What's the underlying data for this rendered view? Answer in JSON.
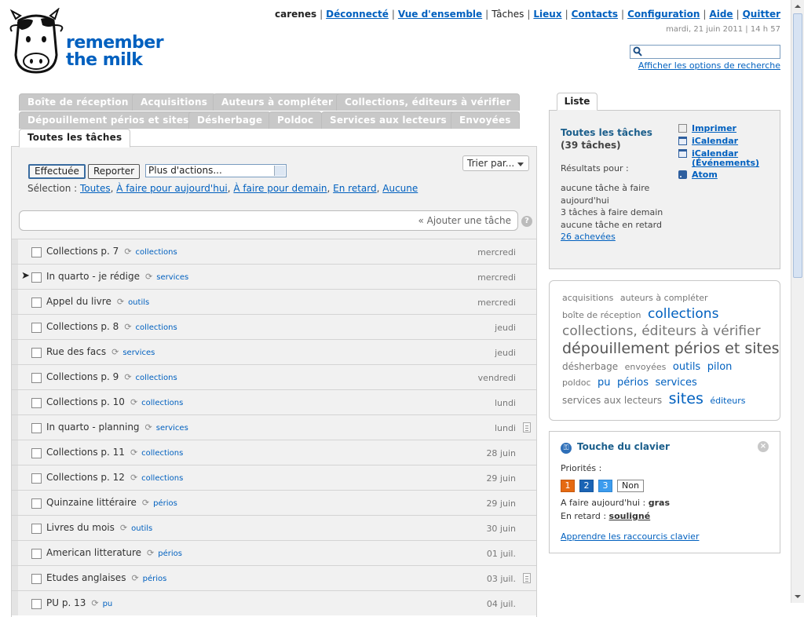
{
  "logo": {
    "line1": "remember",
    "line2": "the milk"
  },
  "topnav": {
    "user": "carenes",
    "logout": "Déconnecté",
    "overview": "Vue d'ensemble",
    "tasks": "Tâches",
    "places": "Lieux",
    "contacts": "Contacts",
    "settings": "Configuration",
    "help": "Aide",
    "quit": "Quitter"
  },
  "datetime": "mardi, 21 juin 2011 | 14 h 57",
  "search": {
    "value": "",
    "options_link": "Afficher les options de recherche"
  },
  "tabs": {
    "inbox": "Boîte de réception",
    "acquisitions": "Acquisitions",
    "authors": "Auteurs à compléter",
    "collections": "Collections, éditeurs à vérifier",
    "depouillement": "Dépouillement périos et sites",
    "desherbage": "Désherbage",
    "poldoc": "Poldoc",
    "services": "Services aux lecteurs",
    "sent": "Envoyées",
    "all": "Toutes les tâches"
  },
  "toolbar": {
    "done": "Effectuée",
    "postpone": "Reporter",
    "more_actions": "Plus d'actions...",
    "sort": "Trier par..."
  },
  "selection": {
    "label": "Sélection :",
    "all": "Toutes",
    "today": "À faire pour aujourd'hui",
    "tomorrow": "À faire pour demain",
    "overdue": "En retard",
    "none": "Aucune"
  },
  "add_task": "« Ajouter une tâche",
  "help_glyph": "?",
  "tasks": [
    {
      "name": "Collections p. 7",
      "tag": "collections",
      "date": "mercredi"
    },
    {
      "name": "In quarto - je rédige",
      "tag": "services",
      "date": "mercredi"
    },
    {
      "name": "Appel du livre",
      "tag": "outils",
      "date": "mercredi"
    },
    {
      "name": "Collections p. 8",
      "tag": "collections",
      "date": "jeudi"
    },
    {
      "name": "Rue des facs",
      "tag": "services",
      "date": "jeudi"
    },
    {
      "name": "Collections p. 9",
      "tag": "collections",
      "date": "vendredi"
    },
    {
      "name": "Collections p. 10",
      "tag": "collections",
      "date": "lundi"
    },
    {
      "name": "In quarto - planning",
      "tag": "services",
      "date": "lundi"
    },
    {
      "name": "Collections p. 11",
      "tag": "collections",
      "date": "28 juin"
    },
    {
      "name": "Collections p. 12",
      "tag": "collections",
      "date": "29 juin"
    },
    {
      "name": "Quinzaine littéraire",
      "tag": "périos",
      "date": "29 juin"
    },
    {
      "name": "Livres du mois",
      "tag": "outils",
      "date": "30 juin"
    },
    {
      "name": "American litterature",
      "tag": "périos",
      "date": "01 juil."
    },
    {
      "name": "Etudes anglaises",
      "tag": "périos",
      "date": "03 juil."
    },
    {
      "name": "PU p. 13",
      "tag": "pu",
      "date": "04 juil."
    }
  ],
  "list_panel": {
    "tab": "Liste",
    "title": "Toutes les tâches",
    "count": "(39 tâches)",
    "results_label": "Résultats pour :",
    "today": "aucune tâche à faire aujourd'hui",
    "tomorrow": "3 tâches à faire demain",
    "overdue": "aucune tâche en retard",
    "completed": "26 achevées",
    "print": "Imprimer",
    "icalendar": "iCalendar",
    "icalendar_events": "iCalendar (Événements)",
    "atom": "Atom"
  },
  "tag_cloud": {
    "acquisitions": "acquisitions",
    "auteurs": "auteurs à compléter",
    "boite": "boîte de réception",
    "collections": "collections",
    "coll_editeurs": "collections, éditeurs à vérifier",
    "depouillement": "dépouillement périos et sites",
    "desherbage": "désherbage",
    "envoyees": "envoyées",
    "outils": "outils",
    "pilon": "pilon",
    "poldoc": "poldoc",
    "pu": "pu",
    "perios": "périos",
    "services": "services",
    "services_lecteurs": "services aux lecteurs",
    "sites": "sites",
    "editeurs": "éditeurs"
  },
  "keyboard": {
    "title": "Touche du clavier",
    "close_glyph": "×",
    "key_glyph": "⚿",
    "priorities_label": "Priorités :",
    "p1": "1",
    "p2": "2",
    "p3": "3",
    "pn": "Non",
    "today_label": "A faire aujourd'hui :",
    "today_value": "gras",
    "overdue_label": "En retard :",
    "overdue_value": "souligné",
    "learn": "Apprendre les raccourcis clavier"
  },
  "colors": {
    "link": "#0060bf",
    "priority_1": "#e56a12",
    "priority_2": "#1b64b5",
    "priority_3": "#3c9cee"
  }
}
